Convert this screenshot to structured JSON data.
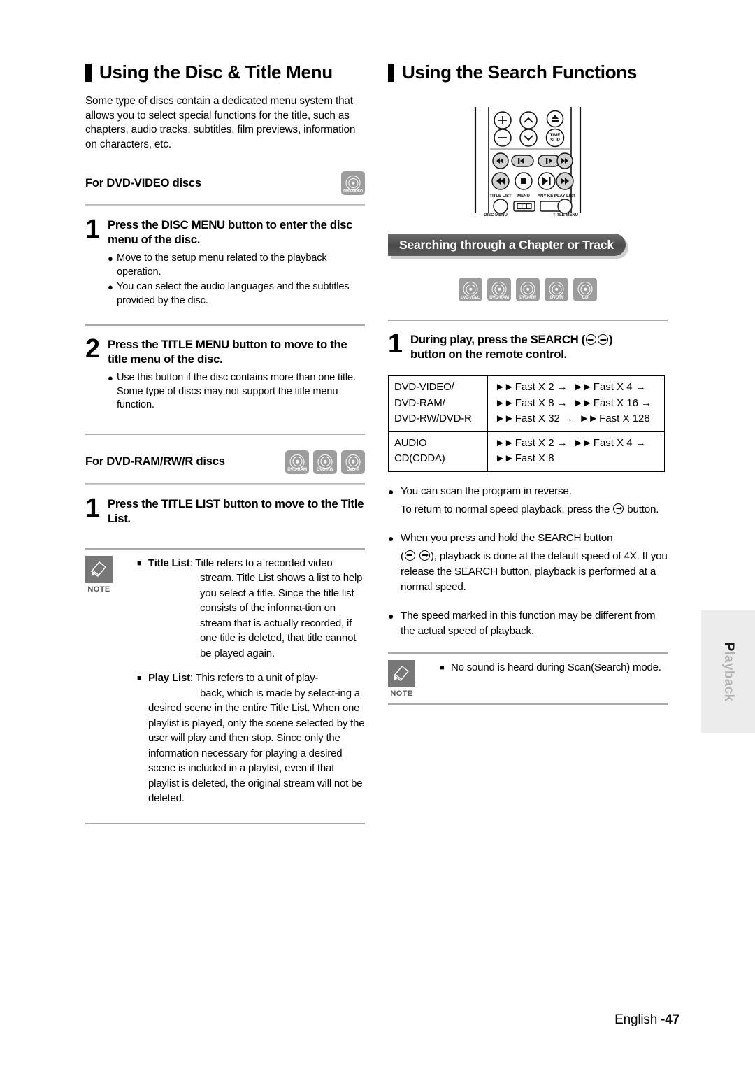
{
  "page": {
    "footer_text": "English -",
    "footer_page": "47",
    "side_tab": {
      "first_letter": "P",
      "rest": "layback"
    }
  },
  "left": {
    "heading": "Using the Disc & Title Menu",
    "intro": "Some type of discs contain a dedicated menu system that allows you to select special functions for the title, such as chapters, audio tracks, subtitles, film previews, information on characters, etc.",
    "dvd_video_section": {
      "title": "For DVD-VIDEO discs",
      "icons": [
        "DVD-VIDEO"
      ],
      "steps": [
        {
          "num": "1",
          "title": "Press the DISC MENU button to enter the disc menu of the disc.",
          "bullets": [
            "Move to the setup menu related to the playback operation.",
            "You can select the audio languages and the subtitles provided by the disc."
          ]
        },
        {
          "num": "2",
          "title": "Press the TITLE MENU button to move to the title menu of the disc.",
          "bullets": [
            "Use this button if the disc contains more than one title. Some type of discs may not support the title menu function."
          ]
        }
      ]
    },
    "dvd_ram_section": {
      "title": "For DVD-RAM/RW/R discs",
      "icons": [
        "DVD-RAM",
        "DVD-RW",
        "DVD-R"
      ],
      "steps": [
        {
          "num": "1",
          "title": "Press the TITLE LIST button to move to the Title List.",
          "bullets": []
        }
      ]
    },
    "note": {
      "word": "NOTE",
      "items": [
        {
          "lead": "Title List",
          "lead_sep": ": ",
          "first_line": "Title refers to a recorded video",
          "rest": "stream. Title List shows a list to help you select a title. Since the title list consists of the informa-tion on stream that is actually recorded, if one title is deleted, that title cannot be played again."
        },
        {
          "lead": "Play List",
          "lead_sep": ": ",
          "first_line": "This refers to a unit of play-",
          "rest": "back, which is made by select-ing a desired scene in the entire Title List. When one playlist is played, only the scene selected by the user will play and then stop. Since only the information necessary for playing a desired scene is included in a playlist, even if that playlist is deleted, the original stream will not be deleted."
        }
      ]
    }
  },
  "right": {
    "heading": "Using the Search Functions",
    "remote": {
      "buttons": {
        "plus": "+",
        "minus": "−",
        "chan_up": "chevron-up",
        "chan_down": "chevron-down",
        "eject": "eject",
        "time_slip_line1": "TIME",
        "time_slip_line2": "SLIP",
        "labels_top": [
          "TITLE LIST",
          "MENU",
          "ANY KEY",
          "PLAY LIST"
        ],
        "labels_bottom": [
          "DISC MENU",
          "TITLE MENU"
        ]
      }
    },
    "ribbon": "Searching through a Chapter or Track",
    "icons": [
      "DVD-VIDEO",
      "DVD-RAM",
      "DVD-RW",
      "DVD-R",
      "CD"
    ],
    "step": {
      "num": "1",
      "title_part1": "During play, press the SEARCH (",
      "title_part2": ")",
      "title_line2": "button on the remote control."
    },
    "table": [
      {
        "labels": [
          "DVD-VIDEO/",
          "DVD-RAM/",
          "DVD-RW/DVD-R"
        ],
        "values": [
          "Fast X 2 →   Fast X 4 →",
          "Fast X 8 →   Fast X 16 →",
          "Fast X 32 →   Fast X 128"
        ],
        "value_rows": [
          [
            "Fast X 2 →",
            "Fast X 4 →"
          ],
          [
            "Fast X 8 →",
            "Fast X 16 →"
          ],
          [
            "Fast X 32 →",
            "Fast X 128"
          ]
        ]
      },
      {
        "labels": [
          "AUDIO",
          "CD(CDDA)"
        ],
        "value_rows": [
          [
            "Fast X 2 →",
            "Fast X 4 →"
          ],
          [
            "Fast X 8"
          ]
        ]
      }
    ],
    "bullets": [
      {
        "line1": "You can scan the program in reverse.",
        "line2_a": "To return to normal speed playback, press the",
        "line2_b": "button."
      },
      {
        "line1": "When you press and hold the SEARCH button",
        "line2_a": "(",
        "line2_b": "), playback is done at the default speed of 4X. If you release the SEARCH button, playback is performed at a normal speed."
      },
      {
        "line1": "The speed marked in this function may be different from the actual speed of playback."
      }
    ],
    "note": {
      "word": "NOTE",
      "items": [
        "No sound is heard during Scan(Search) mode."
      ]
    }
  }
}
